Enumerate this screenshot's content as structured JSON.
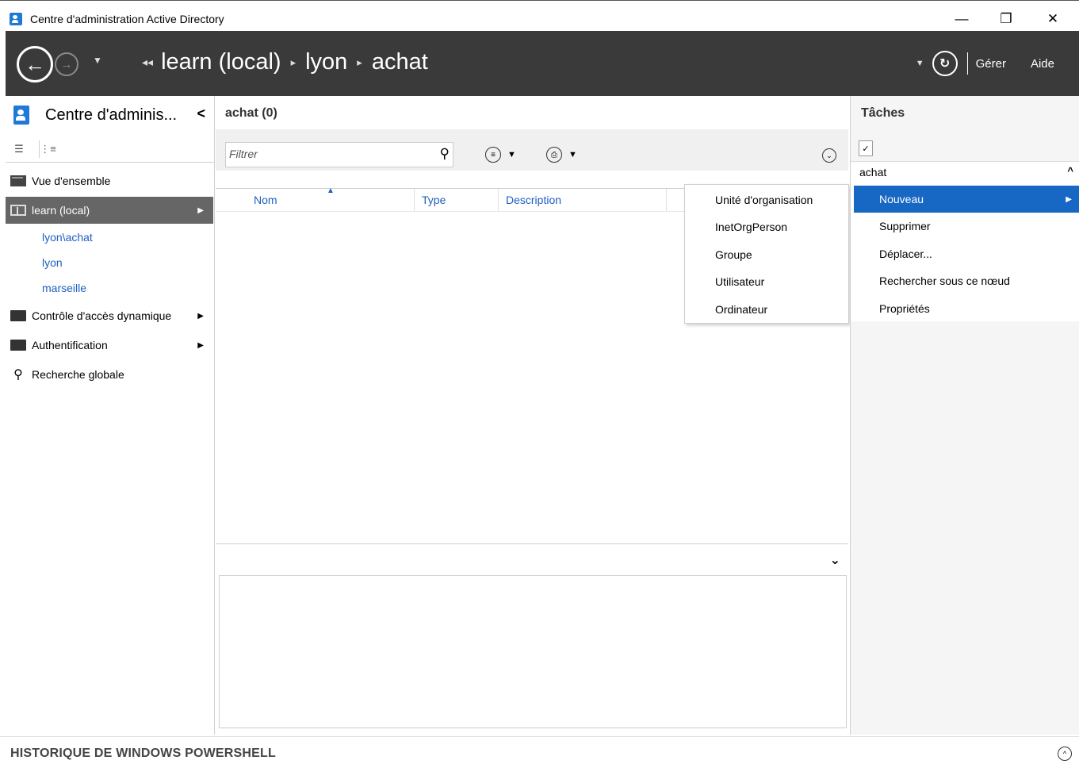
{
  "window": {
    "title": "Centre d'administration Active Directory",
    "minimize": "—",
    "restore": "❐",
    "close": "✕"
  },
  "navbar": {
    "back_icon": "←",
    "forward_icon": "→",
    "dropdown": "▼",
    "breadcrumb_lead": "◂◂",
    "breadcrumb": [
      "learn (local)",
      "lyon",
      "achat"
    ],
    "breadcrumb_sep": "▸",
    "refresh_icon": "↻",
    "manage": "Gérer",
    "help": "Aide"
  },
  "sidebar": {
    "title": "Centre d'adminis...",
    "collapse_icon": "<",
    "list_view_icon": "☰",
    "tree_view_icon": "⋮≡",
    "items": [
      {
        "label": "Vue d'ensemble",
        "icon": "overview-icon"
      },
      {
        "label": "learn (local)",
        "icon": "domain-icon",
        "arrow": "▶"
      },
      {
        "label": "Contrôle d'accès dynamique",
        "icon": "folder-icon",
        "arrow": "▶"
      },
      {
        "label": "Authentification",
        "icon": "folder-icon",
        "arrow": "▶"
      },
      {
        "label": "Recherche globale",
        "icon": "search-icon"
      }
    ],
    "subitems": [
      "lyon\\achat",
      "lyon",
      "marseille"
    ]
  },
  "main": {
    "header": "achat  (0)",
    "filter_placeholder": "Filtrer",
    "search_icon": "⚲",
    "view_options_icon": "≡",
    "save_query_icon": "⎙",
    "expand_icon": "⌄",
    "columns": [
      "Nom",
      "Type",
      "Description"
    ],
    "sort_indicator": "▲",
    "details_chevron": "⌄"
  },
  "submenu": {
    "items": [
      "Unité d'organisation",
      "InetOrgPerson",
      "Groupe",
      "Utilisateur",
      "Ordinateur"
    ]
  },
  "tasks": {
    "title": "Tâches",
    "section": "achat",
    "section_chevron": "^",
    "items": [
      "Nouveau",
      "Supprimer",
      "Déplacer...",
      "Rechercher sous ce nœud",
      "Propriétés"
    ],
    "active_arrow": "▶"
  },
  "powershell": {
    "label": "HISTORIQUE DE WINDOWS POWERSHELL",
    "expand_icon": "^"
  },
  "colors": {
    "navbar_bg": "#3a3a3a",
    "accent": "#1767c4",
    "link": "#1e5fbf",
    "selected_nav": "#666666"
  }
}
